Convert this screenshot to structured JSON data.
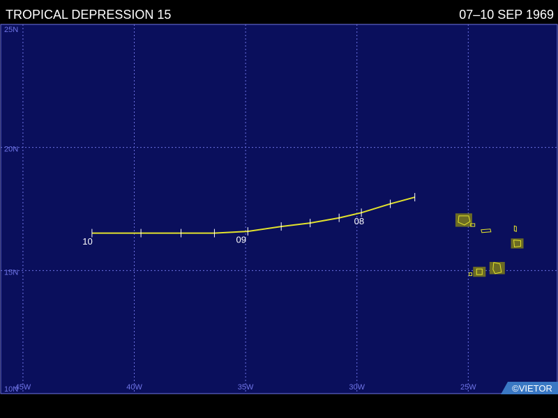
{
  "header": {
    "title": "TROPICAL DEPRESSION 15",
    "dates": "07–10 SEP 1969"
  },
  "map": {
    "lon_range": [
      -46.0,
      -21.0
    ],
    "lat_range": [
      10.0,
      25.0
    ],
    "lat_ticks": [
      {
        "value": 25,
        "label": "25N"
      },
      {
        "value": 20,
        "label": "20N"
      },
      {
        "value": 15,
        "label": "15N"
      },
      {
        "value": 10,
        "label": "10N"
      }
    ],
    "lon_ticks": [
      {
        "value": -45,
        "label": "45W"
      },
      {
        "value": -40,
        "label": "40W"
      },
      {
        "value": -35,
        "label": "35W"
      },
      {
        "value": -30,
        "label": "30W"
      },
      {
        "value": -25,
        "label": "25W"
      }
    ],
    "grid": true,
    "colors": {
      "ocean": "#0a0f5c",
      "grid": "#6f74e6",
      "track": "#e3e32c",
      "tick_label": "#6f74e6",
      "day_label": "#ffffff",
      "land_fill": "#6b6b24",
      "land_outline": "#e3e32c",
      "credit_bg": "#3a78c4",
      "credit_text": "#ffffff"
    },
    "track": [
      {
        "lon": -27.4,
        "lat": 17.98
      },
      {
        "lon": -28.5,
        "lat": 17.71
      },
      {
        "lon": -29.8,
        "lat": 17.35
      },
      {
        "lon": -30.8,
        "lat": 17.14
      },
      {
        "lon": -32.1,
        "lat": 16.93
      },
      {
        "lon": -33.4,
        "lat": 16.79
      },
      {
        "lon": -34.9,
        "lat": 16.59
      },
      {
        "lon": -36.4,
        "lat": 16.52
      },
      {
        "lon": -37.9,
        "lat": 16.52
      },
      {
        "lon": -39.7,
        "lat": 16.52
      },
      {
        "lon": -41.9,
        "lat": 16.52
      }
    ],
    "day_labels": [
      {
        "label": "08",
        "lon": -29.9,
        "lat": 17.22
      },
      {
        "label": "09",
        "lon": -35.2,
        "lat": 16.46
      },
      {
        "label": "10",
        "lon": -42.1,
        "lat": 16.39
      }
    ],
    "islands": [
      {
        "name": "santo-antao",
        "lon": -25.2,
        "lat": 17.05
      },
      {
        "name": "sao-vicente",
        "lon": -24.8,
        "lat": 16.85
      },
      {
        "name": "sao-nicolau",
        "lon": -24.2,
        "lat": 16.6
      },
      {
        "name": "sal",
        "lon": -22.9,
        "lat": 16.7
      },
      {
        "name": "boa-vista",
        "lon": -22.8,
        "lat": 16.1
      },
      {
        "name": "maio",
        "lon": -23.5,
        "lat": 15.0
      },
      {
        "name": "santiago",
        "lon": -23.7,
        "lat": 15.1
      },
      {
        "name": "fogo",
        "lon": -24.5,
        "lat": 14.95
      },
      {
        "name": "brava",
        "lon": -24.9,
        "lat": 14.85
      }
    ],
    "credit": "©VIETOR"
  }
}
